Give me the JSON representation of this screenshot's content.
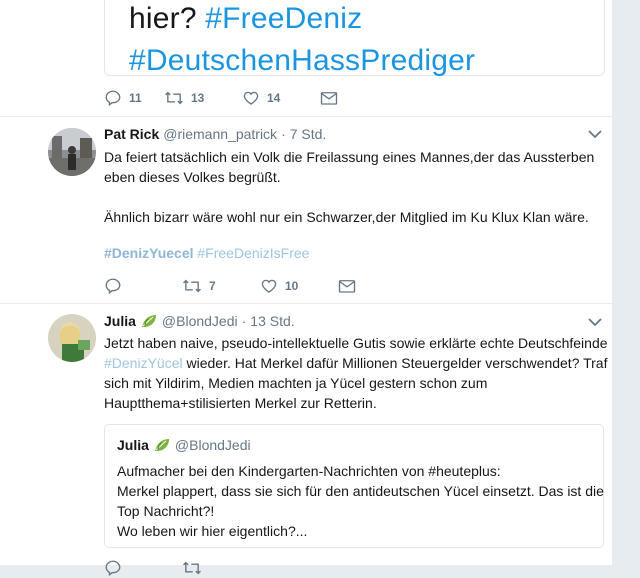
{
  "top_tweet": {
    "card_line1_text": "hier? ",
    "card_line1_tag": "#FreeDeniz",
    "card_line2_tag": "#DeutschenHassPrediger",
    "replies": "11",
    "retweets": "13",
    "likes": "14"
  },
  "tweets": [
    {
      "name": "Pat Rick",
      "handle": "@riemann_patrick",
      "separator": "·",
      "time": "7 Std.",
      "lines": [
        "Da feiert tatsächlich ein Volk die Freilassung eines Mannes,der das Aussterben",
        "eben dieses Volkes begrüßt.",
        "",
        "Ähnlich bizarr wäre wohl nur ein Schwarzer,der Mitglied im Ku Klux Klan wäre."
      ],
      "hashtag_bold": "#DenizYuecel",
      "hashtag_plain": "#FreeDenizIsFree",
      "replies": "",
      "retweets": "7",
      "likes": "10"
    },
    {
      "name": "Julia",
      "handle": "@BlondJedi",
      "separator": "·",
      "time": "13 Std.",
      "line1": "Jetzt haben naive, pseudo-intellektuelle Gutis sowie erklärte echte Deutschfeinde",
      "line2_tag": "#DenizYücel",
      "line2_text": " wieder. Hat Merkel dafür Millionen Steuergelder verschwendet? Traf",
      "line3": "sich mit Yildirim, Medien machten ja Yücel gestern schon zum",
      "line4": "Hauptthema+stilisierten Merkel zur Retterin.",
      "quote": {
        "name": "Julia",
        "handle": "@BlondJedi",
        "lines": [
          "Aufmacher bei den Kindergarten-Nachrichten von #heuteplus:",
          "Merkel plappert, dass sie sich für den antideutschen Yücel einsetzt. Das ist die",
          "Top Nachricht?!",
          "Wo leben wir hier eigentlich?..."
        ]
      }
    }
  ],
  "colors": {
    "link": "#1b95e0",
    "muted": "#657786",
    "border": "#e6ecf0",
    "leaf": "#7cb342"
  },
  "icons": [
    "reply-icon",
    "retweet-icon",
    "like-icon",
    "dm-icon",
    "chevron-down-icon",
    "leaf-emoji-icon"
  ]
}
